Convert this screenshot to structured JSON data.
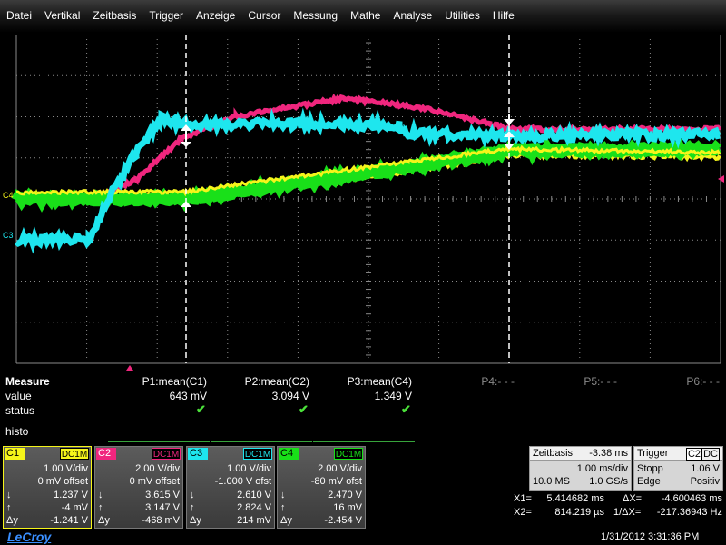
{
  "menu": [
    "Datei",
    "Vertikal",
    "Zeitbasis",
    "Trigger",
    "Anzeige",
    "Cursor",
    "Messung",
    "Mathe",
    "Analyse",
    "Utilities",
    "Hilfe"
  ],
  "colors": {
    "c1": "#f5f51a",
    "c2": "#f0267e",
    "c3": "#1ee6ee",
    "c4": "#19e019",
    "grid": "#8a8a8a",
    "measure_ok": "#4be13a"
  },
  "grid_markers": {
    "c4_label": "C4",
    "c3_label": "C3"
  },
  "measure": {
    "title": "Measure",
    "row_value": "value",
    "row_status": "status",
    "params": [
      {
        "name": "P1:mean(C1)",
        "value": "643 mV",
        "status": "ok"
      },
      {
        "name": "P2:mean(C2)",
        "value": "3.094 V",
        "status": "ok"
      },
      {
        "name": "P3:mean(C4)",
        "value": "1.349 V",
        "status": "ok"
      },
      {
        "name": "P4:- - -",
        "value": "",
        "status": ""
      },
      {
        "name": "P5:- - -",
        "value": "",
        "status": ""
      },
      {
        "name": "P6:- - -",
        "value": "",
        "status": ""
      }
    ],
    "histo": "histo"
  },
  "channels": [
    {
      "id": "C1",
      "coupling": "DC1M",
      "vdiv": "1.00 V/div",
      "offset": "0 mV offset",
      "down": "1.237 V",
      "up": "-4 mV",
      "dy": "-1.241 V"
    },
    {
      "id": "C2",
      "coupling": "DC1M",
      "vdiv": "2.00 V/div",
      "offset": "0 mV offset",
      "down": "3.615 V",
      "up": "3.147 V",
      "dy": "-468 mV"
    },
    {
      "id": "C3",
      "coupling": "DC1M",
      "vdiv": "1.00 V/div",
      "offset": "-1.000 V ofst",
      "down": "2.610 V",
      "up": "2.824 V",
      "dy": "214 mV"
    },
    {
      "id": "C4",
      "coupling": "DC1M",
      "vdiv": "2.00 V/div",
      "offset": "-80 mV ofst",
      "down": "2.470 V",
      "up": "16 mV",
      "dy": "-2.454 V"
    }
  ],
  "timebase": {
    "label": "Zeitbasis",
    "delay": "-3.38 ms",
    "tdiv": "1.00 ms/div",
    "samples": "10.0 MS",
    "rate": "1.0 GS/s"
  },
  "trigger": {
    "label": "Trigger",
    "source": "C2",
    "coupling": "DC",
    "mode": "Stopp",
    "level": "1.06 V",
    "type": "Edge",
    "slope": "Positiv"
  },
  "cursors": {
    "x1_label": "X1=",
    "x1": "5.414682 ms",
    "dx_label": "ΔX=",
    "dx": "-4.600463 ms",
    "x2_label": "X2=",
    "x2": "814.219 µs",
    "inv_dx_label": "1/ΔX=",
    "inv_dx": "-217.36943 Hz"
  },
  "brand": "LeCroy",
  "datetime": "1/31/2012 3:31:36 PM"
}
